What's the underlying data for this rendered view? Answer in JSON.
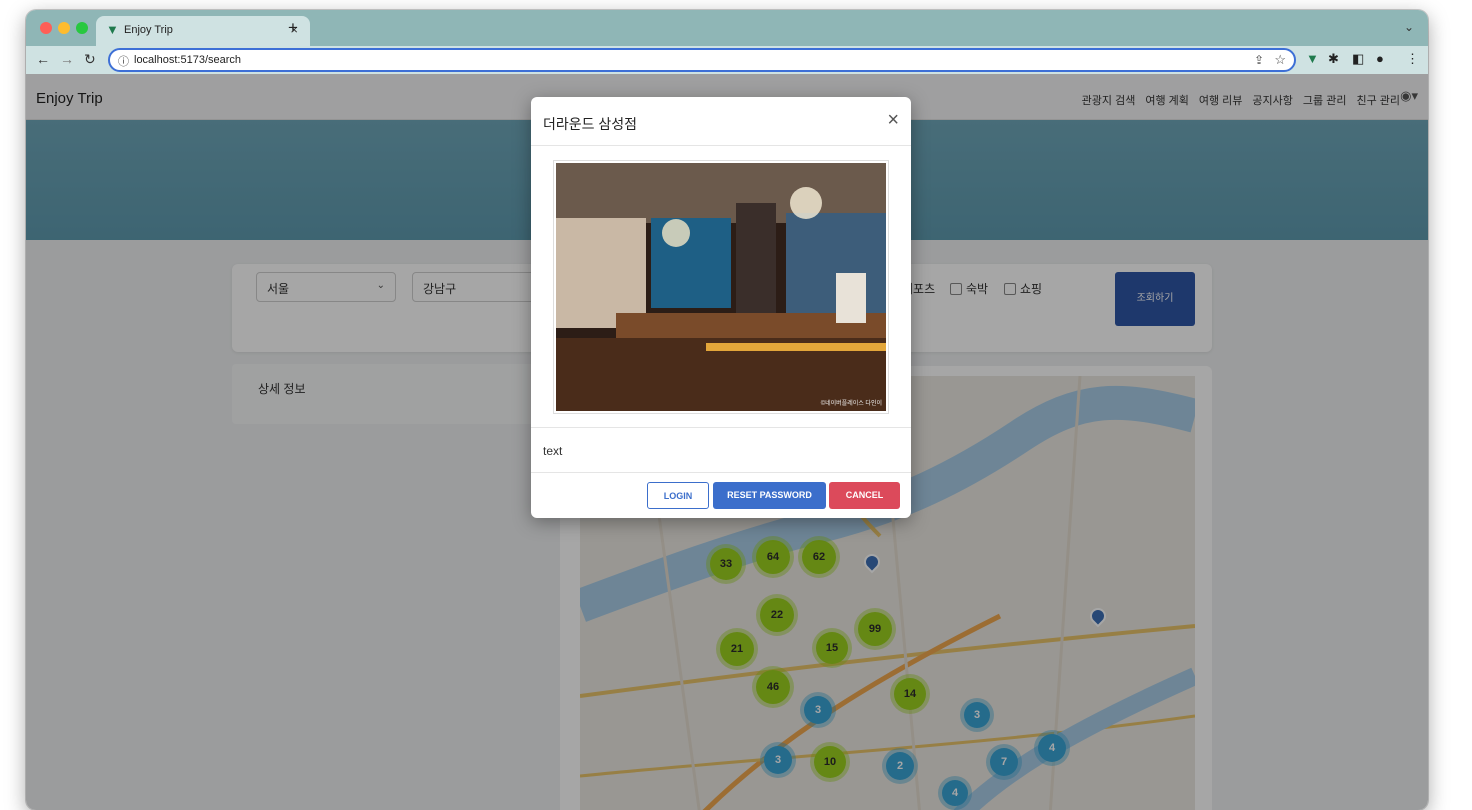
{
  "browser": {
    "tab_title": "Enjoy Trip",
    "tab_close": "×",
    "new_tab": "+",
    "url_scheme_icon": "ⓘ",
    "url": "localhost:5173/search"
  },
  "app": {
    "brand": "Enjoy Trip",
    "menu": [
      "관광지 검색",
      "여행 계획",
      "여행 리뷰",
      "공지사항",
      "그룹 관리",
      "친구 관리"
    ]
  },
  "search": {
    "region": "서울",
    "district": "강남구",
    "categories_visible": [
      "레포츠",
      "숙박",
      "쇼핑"
    ],
    "button": "조회하기"
  },
  "detail": {
    "title": "상세 정보"
  },
  "map": {
    "clusters": [
      {
        "label": "33",
        "color": "#9bd11f"
      },
      {
        "label": "64",
        "color": "#9bd11f"
      },
      {
        "label": "62",
        "color": "#9bd11f"
      },
      {
        "label": "22",
        "color": "#9bd11f"
      },
      {
        "label": "99",
        "color": "#9bd11f"
      },
      {
        "label": "21",
        "color": "#9bd11f"
      },
      {
        "label": "15",
        "color": "#9bd11f"
      },
      {
        "label": "46",
        "color": "#9bd11f"
      },
      {
        "label": "14",
        "color": "#9bd11f"
      },
      {
        "label": "10",
        "color": "#9bd11f"
      },
      {
        "label": "3",
        "color": "#3aa5d6"
      },
      {
        "label": "3",
        "color": "#3aa5d6"
      },
      {
        "label": "3",
        "color": "#3aa5d6"
      },
      {
        "label": "2",
        "color": "#3aa5d6"
      },
      {
        "label": "7",
        "color": "#3aa5d6"
      },
      {
        "label": "4",
        "color": "#3aa5d6"
      },
      {
        "label": "4",
        "color": "#3aa5d6"
      }
    ]
  },
  "modal": {
    "title": "더라운드 삼성점",
    "close": "×",
    "image_caption": "©네이버플레이스 다인이",
    "text": "text",
    "buttons": {
      "login": "LOGIN",
      "reset": "RESET PASSWORD",
      "cancel": "CANCEL"
    }
  },
  "colors": {
    "accent_blue": "#3b6ecb",
    "cancel_red": "#dc4a5b",
    "hero_teal": "#6fa8ba"
  }
}
